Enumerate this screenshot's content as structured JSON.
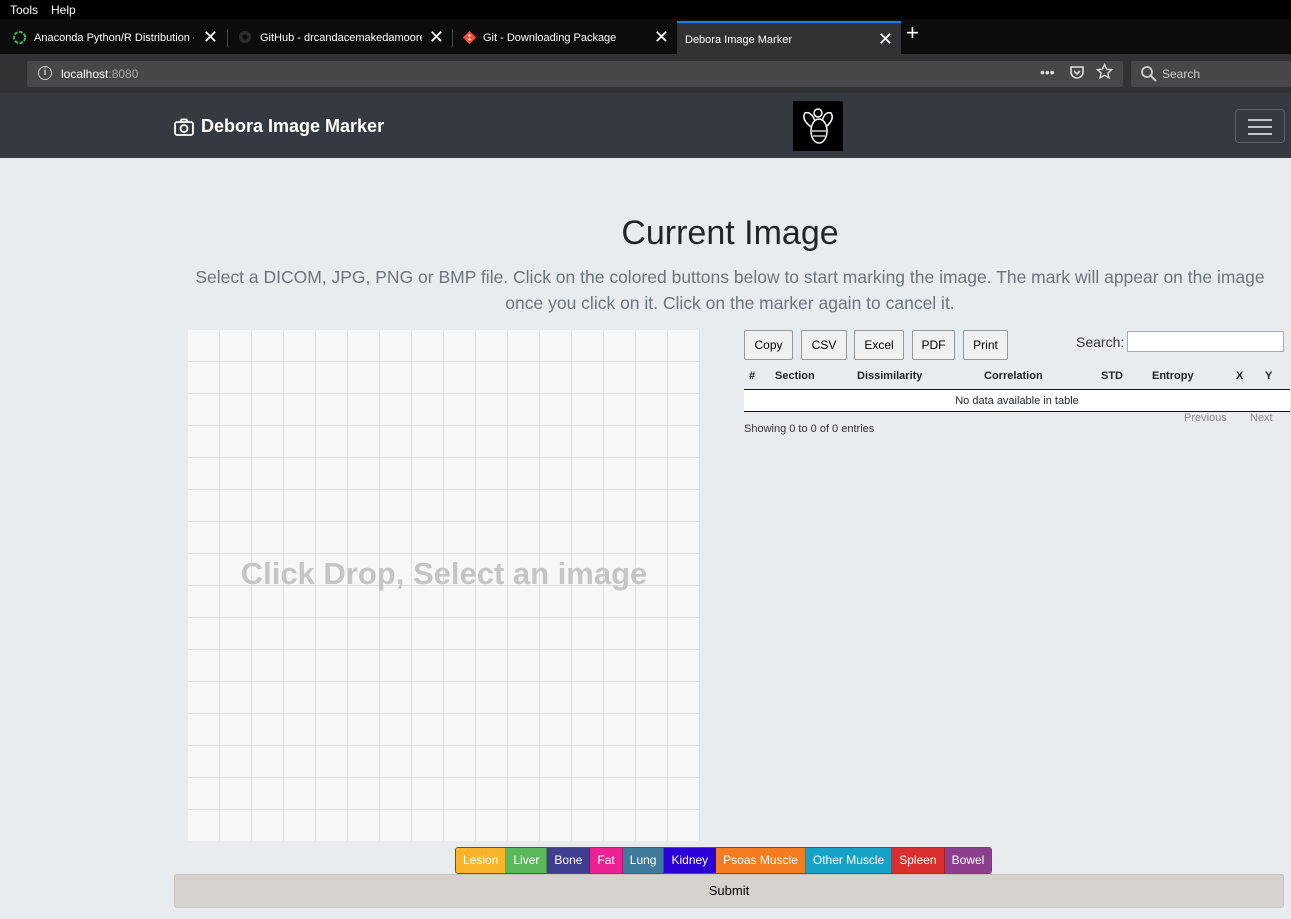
{
  "browser": {
    "menu": [
      "Tools",
      "Help"
    ],
    "tabs": [
      {
        "title": "Anaconda Python/R Distribution - ...",
        "icon": "anaconda-icon"
      },
      {
        "title": "GitHub - drcandacemakedamoore/...",
        "icon": "github-icon"
      },
      {
        "title": "Git - Downloading Package",
        "icon": "git-icon"
      },
      {
        "title": "Debora Image Marker",
        "icon": ""
      }
    ],
    "url_host": "localhost",
    "url_port": ":8080",
    "search_placeholder": "Search"
  },
  "header": {
    "brand": "Debora Image Marker"
  },
  "main": {
    "title": "Current Image",
    "lead": "Select a DICOM, JPG, PNG or BMP file. Click on the colored buttons below to start marking the image. The mark will appear on the image once you click on it. Click on the marker again to cancel it.",
    "dropzone_text": "Click Drop, Select an image"
  },
  "table": {
    "buttons": [
      "Copy",
      "CSV",
      "Excel",
      "PDF",
      "Print"
    ],
    "search_label": "Search:",
    "search_value": "",
    "columns": [
      "#",
      "Section",
      "Dissimilarity",
      "Correlation",
      "STD",
      "Entropy",
      "X",
      "Y"
    ],
    "empty_message": "No data available in table",
    "info": "Showing 0 to 0 of 0 entries",
    "previous": "Previous",
    "next": "Next"
  },
  "markers": [
    {
      "label": "Lesion",
      "color": "#f9b42a"
    },
    {
      "label": "Liver",
      "color": "#5cb85c"
    },
    {
      "label": "Bone",
      "color": "#3f3f8f"
    },
    {
      "label": "Fat",
      "color": "#ea2294"
    },
    {
      "label": "Lung",
      "color": "#3e7a9a"
    },
    {
      "label": "Kidney",
      "color": "#2b00d6"
    },
    {
      "label": "Psoas Muscle",
      "color": "#f47c20"
    },
    {
      "label": "Other Muscle",
      "color": "#17a2c8"
    },
    {
      "label": "Spleen",
      "color": "#db2e2e"
    },
    {
      "label": "Bowel",
      "color": "#8e3e8e"
    }
  ],
  "submit_label": "Submit"
}
